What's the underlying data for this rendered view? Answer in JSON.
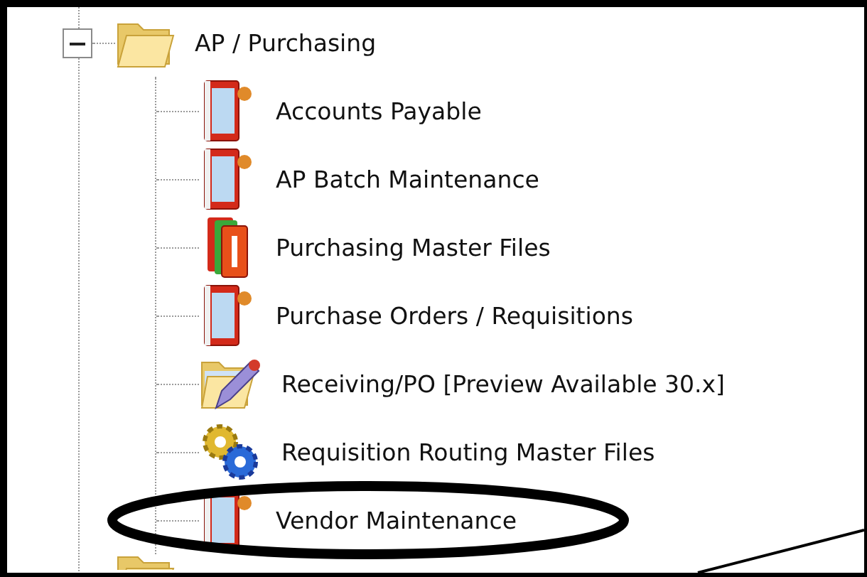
{
  "tree": [
    {
      "label": "AP / Purchasing",
      "kind": "folder",
      "expanded": true,
      "children": [
        {
          "label": "Accounts Payable",
          "kind": "book",
          "circled": false
        },
        {
          "label": "AP Batch Maintenance",
          "kind": "book",
          "circled": false
        },
        {
          "label": "Purchasing Master Files",
          "kind": "books",
          "circled": false
        },
        {
          "label": "Purchase Orders / Requisitions",
          "kind": "book",
          "circled": false
        },
        {
          "label": "Receiving/PO [Preview Available 30.x]",
          "kind": "folder-pencil",
          "circled": false
        },
        {
          "label": "Requisition Routing Master Files",
          "kind": "gears",
          "circled": false
        },
        {
          "label": "Vendor Maintenance",
          "kind": "book",
          "circled": true
        }
      ]
    },
    {
      "kind": "folder"
    }
  ]
}
